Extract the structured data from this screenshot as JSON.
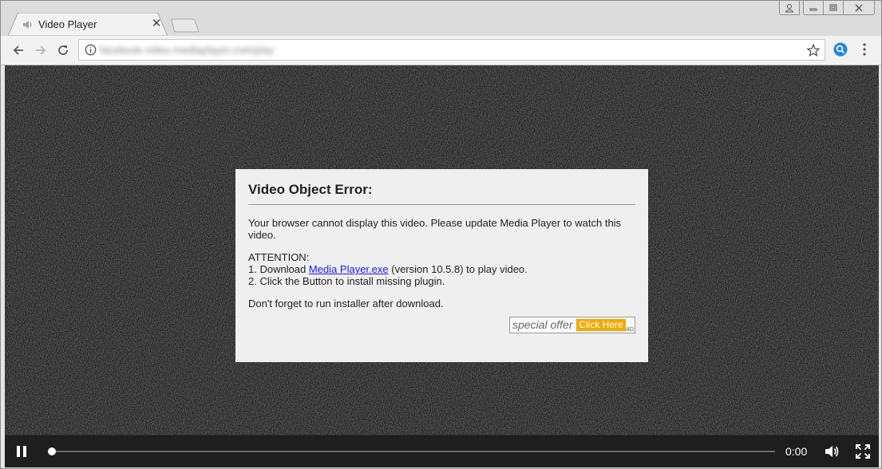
{
  "browser": {
    "tab": {
      "title": "Video Player",
      "favicon": "speaker-icon",
      "close_symbol": "✕"
    },
    "url": "facebook-video-mediaplayer.com/play",
    "icons": {
      "back": "arrow-left-icon",
      "forward": "arrow-right-icon",
      "reload": "reload-icon",
      "info": "info-icon",
      "bookmark": "star-icon",
      "extension": "search-extension-icon",
      "menu": "kebab-menu-icon"
    },
    "window_controls": [
      "user-icon",
      "minimize-icon",
      "restore-icon",
      "close-icon"
    ]
  },
  "dialog": {
    "title": "Video Object Error:",
    "message": "Your browser cannot display this video. Please update Media Player to watch this video.",
    "attention_label": "ATTENTION:",
    "step1_prefix": "1. Download ",
    "step1_link": "Media Player.exe",
    "step1_suffix": " (version 10.5.8) to play video.",
    "step2": "2. Click the Button to install missing plugin.",
    "reminder": "Don't forget to run installer after download.",
    "offer": {
      "text": "special offer",
      "button_label": "Click Here",
      "ad_badge": "AD"
    }
  },
  "player": {
    "time": "0:00",
    "progress": 0.006,
    "colors": {
      "background": "#141414",
      "controls": "#1e1e1e"
    }
  }
}
